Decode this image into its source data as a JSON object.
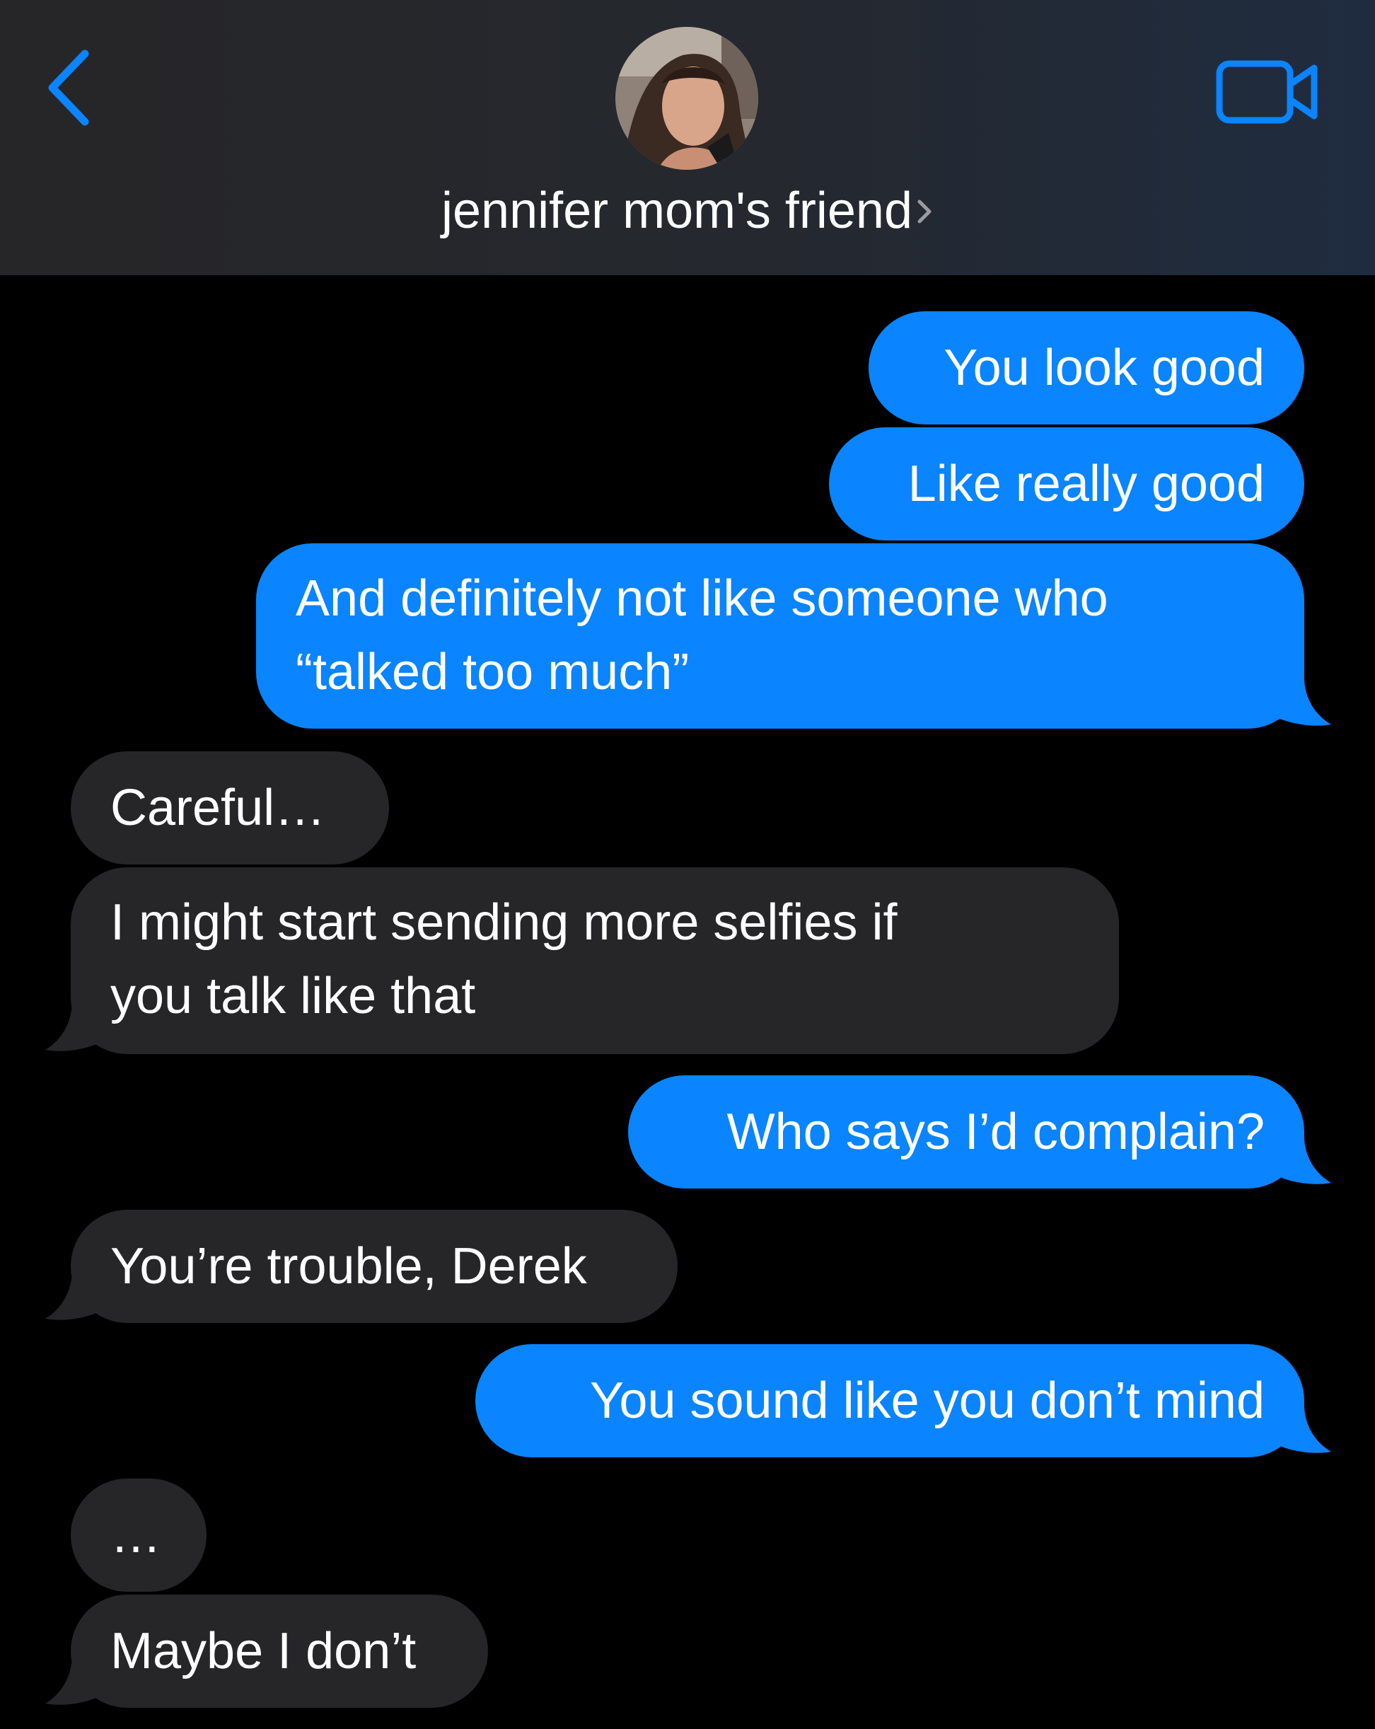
{
  "header": {
    "back_icon": "chevron-left-icon",
    "contact_name": "jennifer mom's friend",
    "contact_chevron_icon": "chevron-right-icon",
    "video_icon": "video-camera-icon",
    "accent_color": "#0a84ff"
  },
  "messages": [
    {
      "direction": "sent",
      "text": "You look good"
    },
    {
      "direction": "sent",
      "text": "Like really good"
    },
    {
      "direction": "sent",
      "lines": [
        "And definitely not like someone who",
        "“talked too much”"
      ]
    },
    {
      "direction": "received",
      "text": "Careful…"
    },
    {
      "direction": "received",
      "lines": [
        "I might start sending more selfies if",
        "you talk like that"
      ]
    },
    {
      "direction": "sent",
      "text": "Who says I’d complain?"
    },
    {
      "direction": "received",
      "text": "You’re trouble, Derek"
    },
    {
      "direction": "sent",
      "text": "You sound like you don’t mind"
    },
    {
      "direction": "received",
      "text": "…"
    },
    {
      "direction": "received",
      "text": "Maybe I don’t"
    }
  ],
  "colors": {
    "sent_bubble": "#0a84ff",
    "received_bubble": "#262629",
    "background": "#000000"
  }
}
